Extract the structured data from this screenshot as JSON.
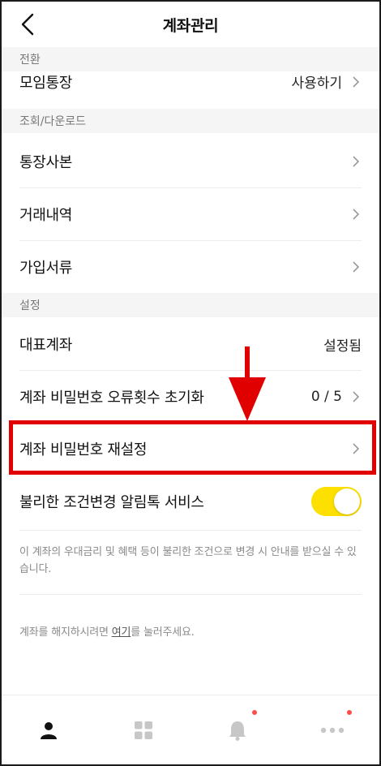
{
  "header": {
    "title": "계좌관리",
    "back_icon": "back-chevron-icon"
  },
  "sections": {
    "switch": {
      "header": "전환",
      "items": [
        {
          "label": "모임통장",
          "value": "사용하기"
        }
      ]
    },
    "inquiry": {
      "header": "조회/다운로드",
      "items": [
        {
          "label": "통장사본"
        },
        {
          "label": "거래내역"
        },
        {
          "label": "가입서류"
        }
      ]
    },
    "settings": {
      "header": "설정",
      "items": [
        {
          "label": "대표계좌",
          "value": "설정됨"
        },
        {
          "label": "계좌 비밀번호 오류횟수 초기화",
          "value": "0 / 5"
        },
        {
          "label": "계좌 비밀번호 재설정"
        },
        {
          "label": "불리한 조건변경 알림톡 서비스",
          "toggle_on": true
        }
      ]
    }
  },
  "notice": {
    "text": "이 계좌의 우대금리 및 혜택 등이 불리한 조건으로 변경 시 안내를 받으실 수 있습니다.",
    "close_prefix": "계좌를 해지하시려면 ",
    "close_link": "여기",
    "close_suffix": "를 눌러주세요."
  },
  "tabbar": {
    "tabs": [
      {
        "icon": "person-icon",
        "active": true
      },
      {
        "icon": "grid-icon",
        "active": false
      },
      {
        "icon": "bell-icon",
        "active": false,
        "badge": true
      },
      {
        "icon": "more-icon",
        "active": false,
        "badge": true
      }
    ]
  },
  "colors": {
    "accent_toggle": "#fde000",
    "badge": "#ff4d4d",
    "highlight": "#e00000"
  }
}
